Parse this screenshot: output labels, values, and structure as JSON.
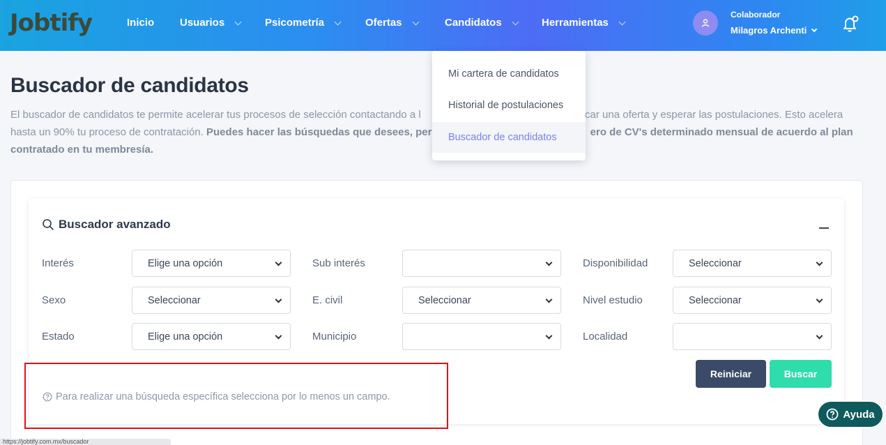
{
  "header": {
    "logo_text": "Jobtify",
    "nav": [
      {
        "label": "Inicio"
      },
      {
        "label": "Usuarios"
      },
      {
        "label": "Psicometría"
      },
      {
        "label": "Ofertas"
      },
      {
        "label": "Candidatos"
      },
      {
        "label": "Herramientas"
      }
    ],
    "user_role": "Colaborador",
    "user_name": "Milagros Archenti"
  },
  "dropdown": {
    "items": [
      {
        "label": "Mi cartera de candidatos"
      },
      {
        "label": "Historial de postulaciones"
      },
      {
        "label": "Buscador de candidatos"
      }
    ]
  },
  "page": {
    "title": "Buscador de candidatos",
    "desc_part1": "El buscador de candidatos te permite acelerar tus procesos de selección contactando a l",
    "desc_part2": "ublicar una oferta y esperar las postulaciones. Esto acelera",
    "desc_part3": "hasta un 90% tu proceso de contratación. ",
    "desc_bold1": "Puedes hacer las búsquedas que desees, pero",
    "desc_bold2": "ero de CV's determinado mensual de acuerdo al plan",
    "desc_bold3": "contratado en tu membresía."
  },
  "search": {
    "title": "Buscador avanzado",
    "fields": [
      {
        "label": "Interés",
        "value": "Elige una opción"
      },
      {
        "label": "Sub interés",
        "value": ""
      },
      {
        "label": "Disponibilidad",
        "value": "Seleccionar"
      },
      {
        "label": "Sexo",
        "value": "Seleccionar"
      },
      {
        "label": "E. civil",
        "value": "Seleccionar"
      },
      {
        "label": "Nivel estudio",
        "value": "Seleccionar"
      },
      {
        "label": "Estado",
        "value": "Elige una opción"
      },
      {
        "label": "Municipio",
        "value": ""
      },
      {
        "label": "Localidad",
        "value": ""
      }
    ],
    "reset_label": "Reiniciar",
    "search_label": "Buscar",
    "hint": "Para realizar una búsqueda específica selecciona por lo menos un campo."
  },
  "help": {
    "label": "Ayuda"
  },
  "status": {
    "url": "https://jobtify.com.mx/buscador"
  },
  "colors": {
    "accent": "#2fdcab",
    "dark_button": "#3b4a66",
    "help": "#0f5a5c",
    "highlight": "#e0101a"
  }
}
